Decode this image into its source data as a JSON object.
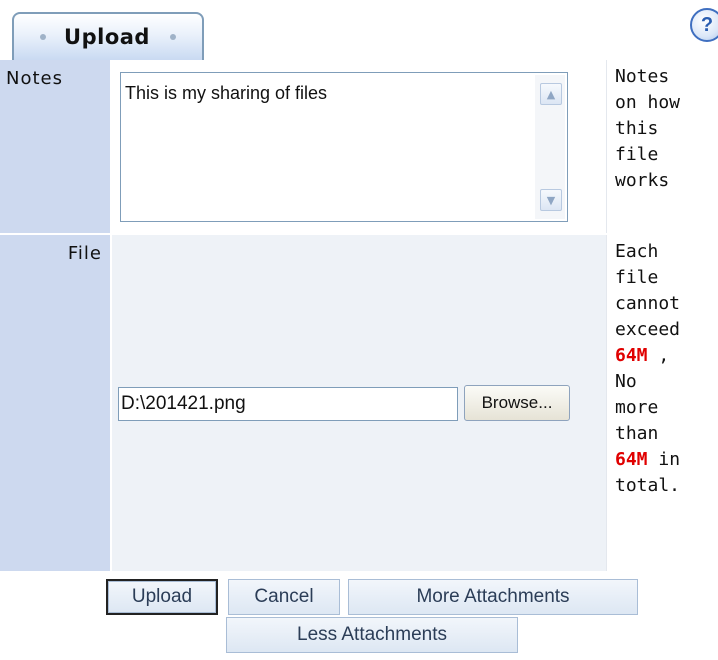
{
  "tab": {
    "label": "Upload",
    "help_label": "?"
  },
  "notes_row": {
    "label": "Notes",
    "value": "This is my sharing of files",
    "hint": [
      "Notes",
      "on how",
      "this",
      "file",
      "works"
    ]
  },
  "file_row": {
    "label": "File",
    "value": "D:\\201421.png",
    "browse_label": "Browse...",
    "hint": {
      "line1": "Each",
      "line2": "file",
      "line3": "cannot",
      "line4": "exceed",
      "limit_per_file": "64M",
      "after_limit": " ,",
      "line6": "No",
      "line7": "more",
      "line8": "than",
      "limit_total": "64M",
      "after_total": " in",
      "line10": "total."
    }
  },
  "buttons": {
    "upload": "Upload",
    "cancel": "Cancel",
    "more_attachments": "More Attachments",
    "less_attachments": "Less Attachments"
  },
  "colors": {
    "label_bg": "#cdd9ef",
    "field_bg": "#eef2f7",
    "limit_red": "#e00000",
    "tab_border": "#7f9db9"
  },
  "icons": {
    "tab_dot": "bullet-dot-icon",
    "help": "question-mark-icon",
    "scroll_up": "arrow-up-icon",
    "scroll_down": "arrow-down-icon"
  }
}
